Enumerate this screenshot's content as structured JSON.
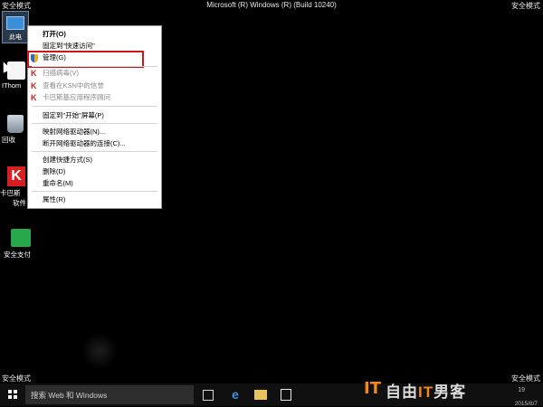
{
  "corners": {
    "top_left": "安全模式",
    "top_right": "安全模式",
    "bottom_left": "安全模式",
    "bottom_right": "安全模式"
  },
  "window_title": "Microsoft (R) Windows (R) (Build 10240)",
  "desktop_icons": {
    "this_pc": "此电",
    "ithome": "IThom",
    "recycle_bin": "回收",
    "kaspersky_line1": "卡巴斯",
    "kaspersky_line2": "软件",
    "kaspersky_glyph": "K",
    "safe_pay": "安全支付"
  },
  "context_menu": {
    "open": "打开(O)",
    "pin_quick_access": "固定到\"快速访问\"",
    "manage": "管理(G)",
    "scan_virus": "扫描病毒(V)",
    "ksn_reputation": "查看在KSN中的信誉",
    "kav_advisor": "卡巴斯基应用程序顾问",
    "pin_start": "固定到\"开始\"屏幕(P)",
    "map_drive": "映射网络驱动器(N)...",
    "disconnect_drive": "断开网络驱动器的连接(C)...",
    "create_shortcut": "创建快捷方式(S)",
    "delete": "删除(D)",
    "rename": "重命名(M)",
    "properties": "属性(R)",
    "highlight_color": "#d01515"
  },
  "taskbar": {
    "search_placeholder": "搜索 Web 和 Windows",
    "edge_glyph": "e",
    "clock": "19",
    "date": "2015/8/7"
  },
  "watermark": {
    "it": "IT",
    "prefix": "自由",
    "it_mid": "IT",
    "suffix": "男客",
    "brand_color": "#f08a1a"
  }
}
